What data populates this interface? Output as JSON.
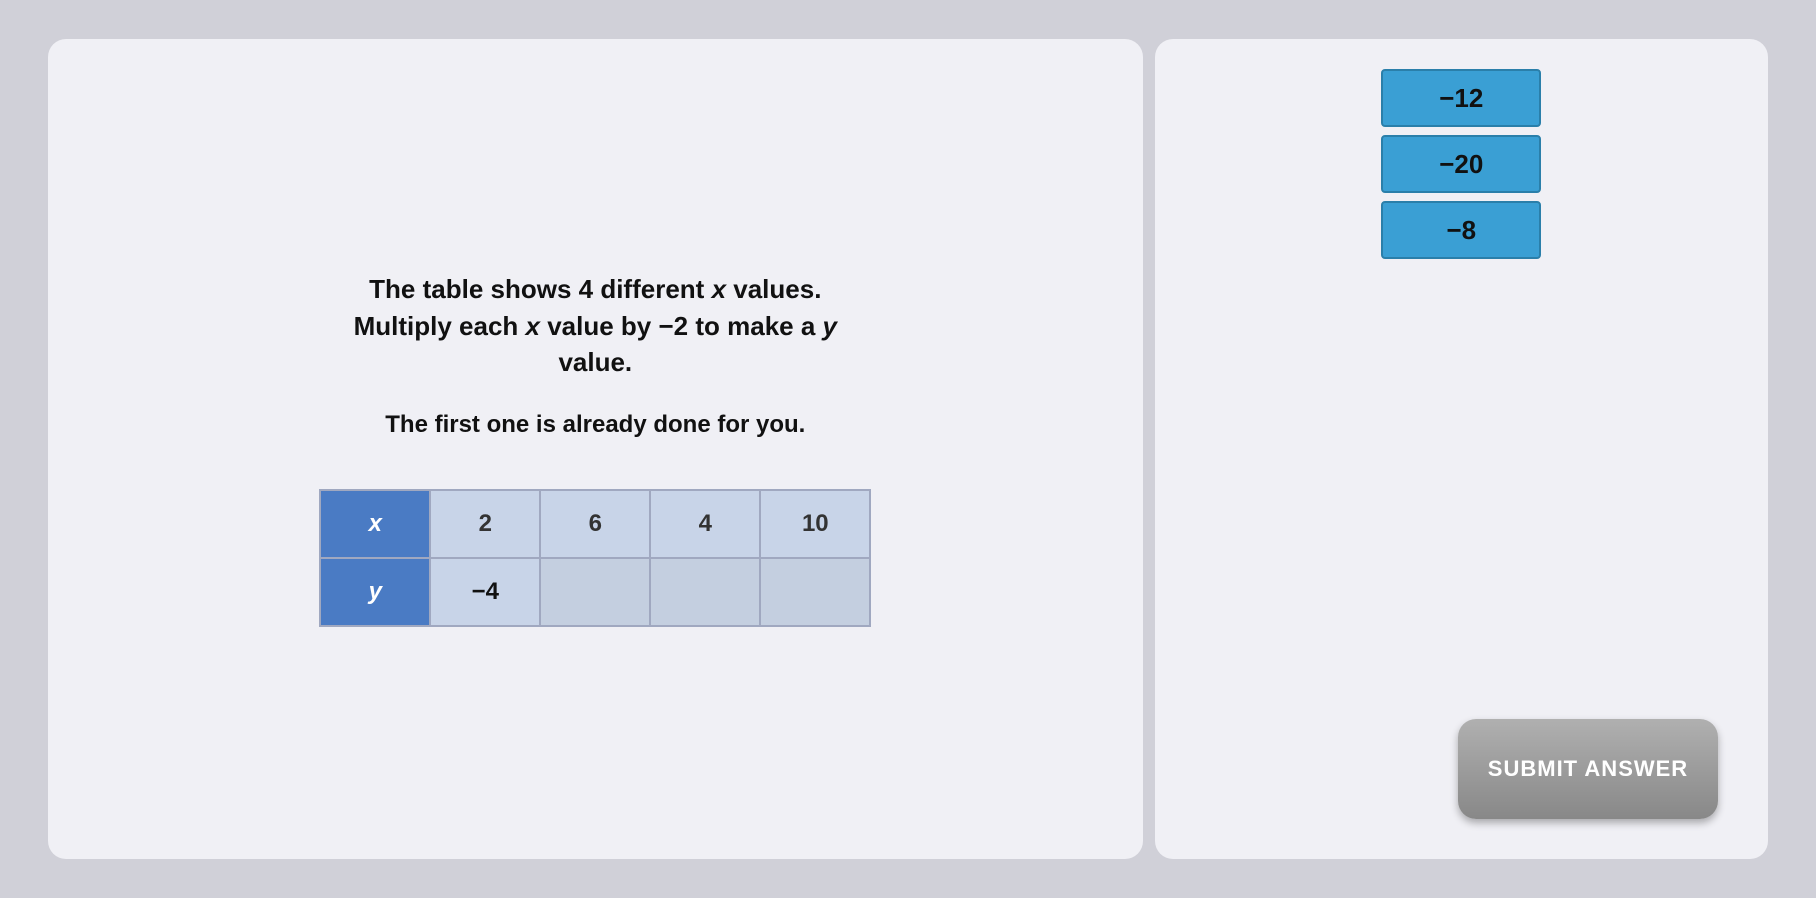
{
  "question": {
    "line1": "The table shows 4 different ",
    "x_var": "x",
    "line1_end": " values.",
    "line2": "Multiply each ",
    "x_var2": "x",
    "line2_mid": " value by −2 to make a ",
    "y_var": "y",
    "line2_end": " value.",
    "subtitle": "The first one is already done for you."
  },
  "table": {
    "header_x": "x",
    "header_y": "y",
    "x_values": [
      "2",
      "6",
      "4",
      "10"
    ],
    "y_first": "−4",
    "y_empty": [
      "",
      "",
      ""
    ]
  },
  "answer_tiles": [
    {
      "value": "−12"
    },
    {
      "value": "−20"
    },
    {
      "value": "−8"
    }
  ],
  "submit_button": {
    "label": "SUBMIT ANSWER"
  }
}
